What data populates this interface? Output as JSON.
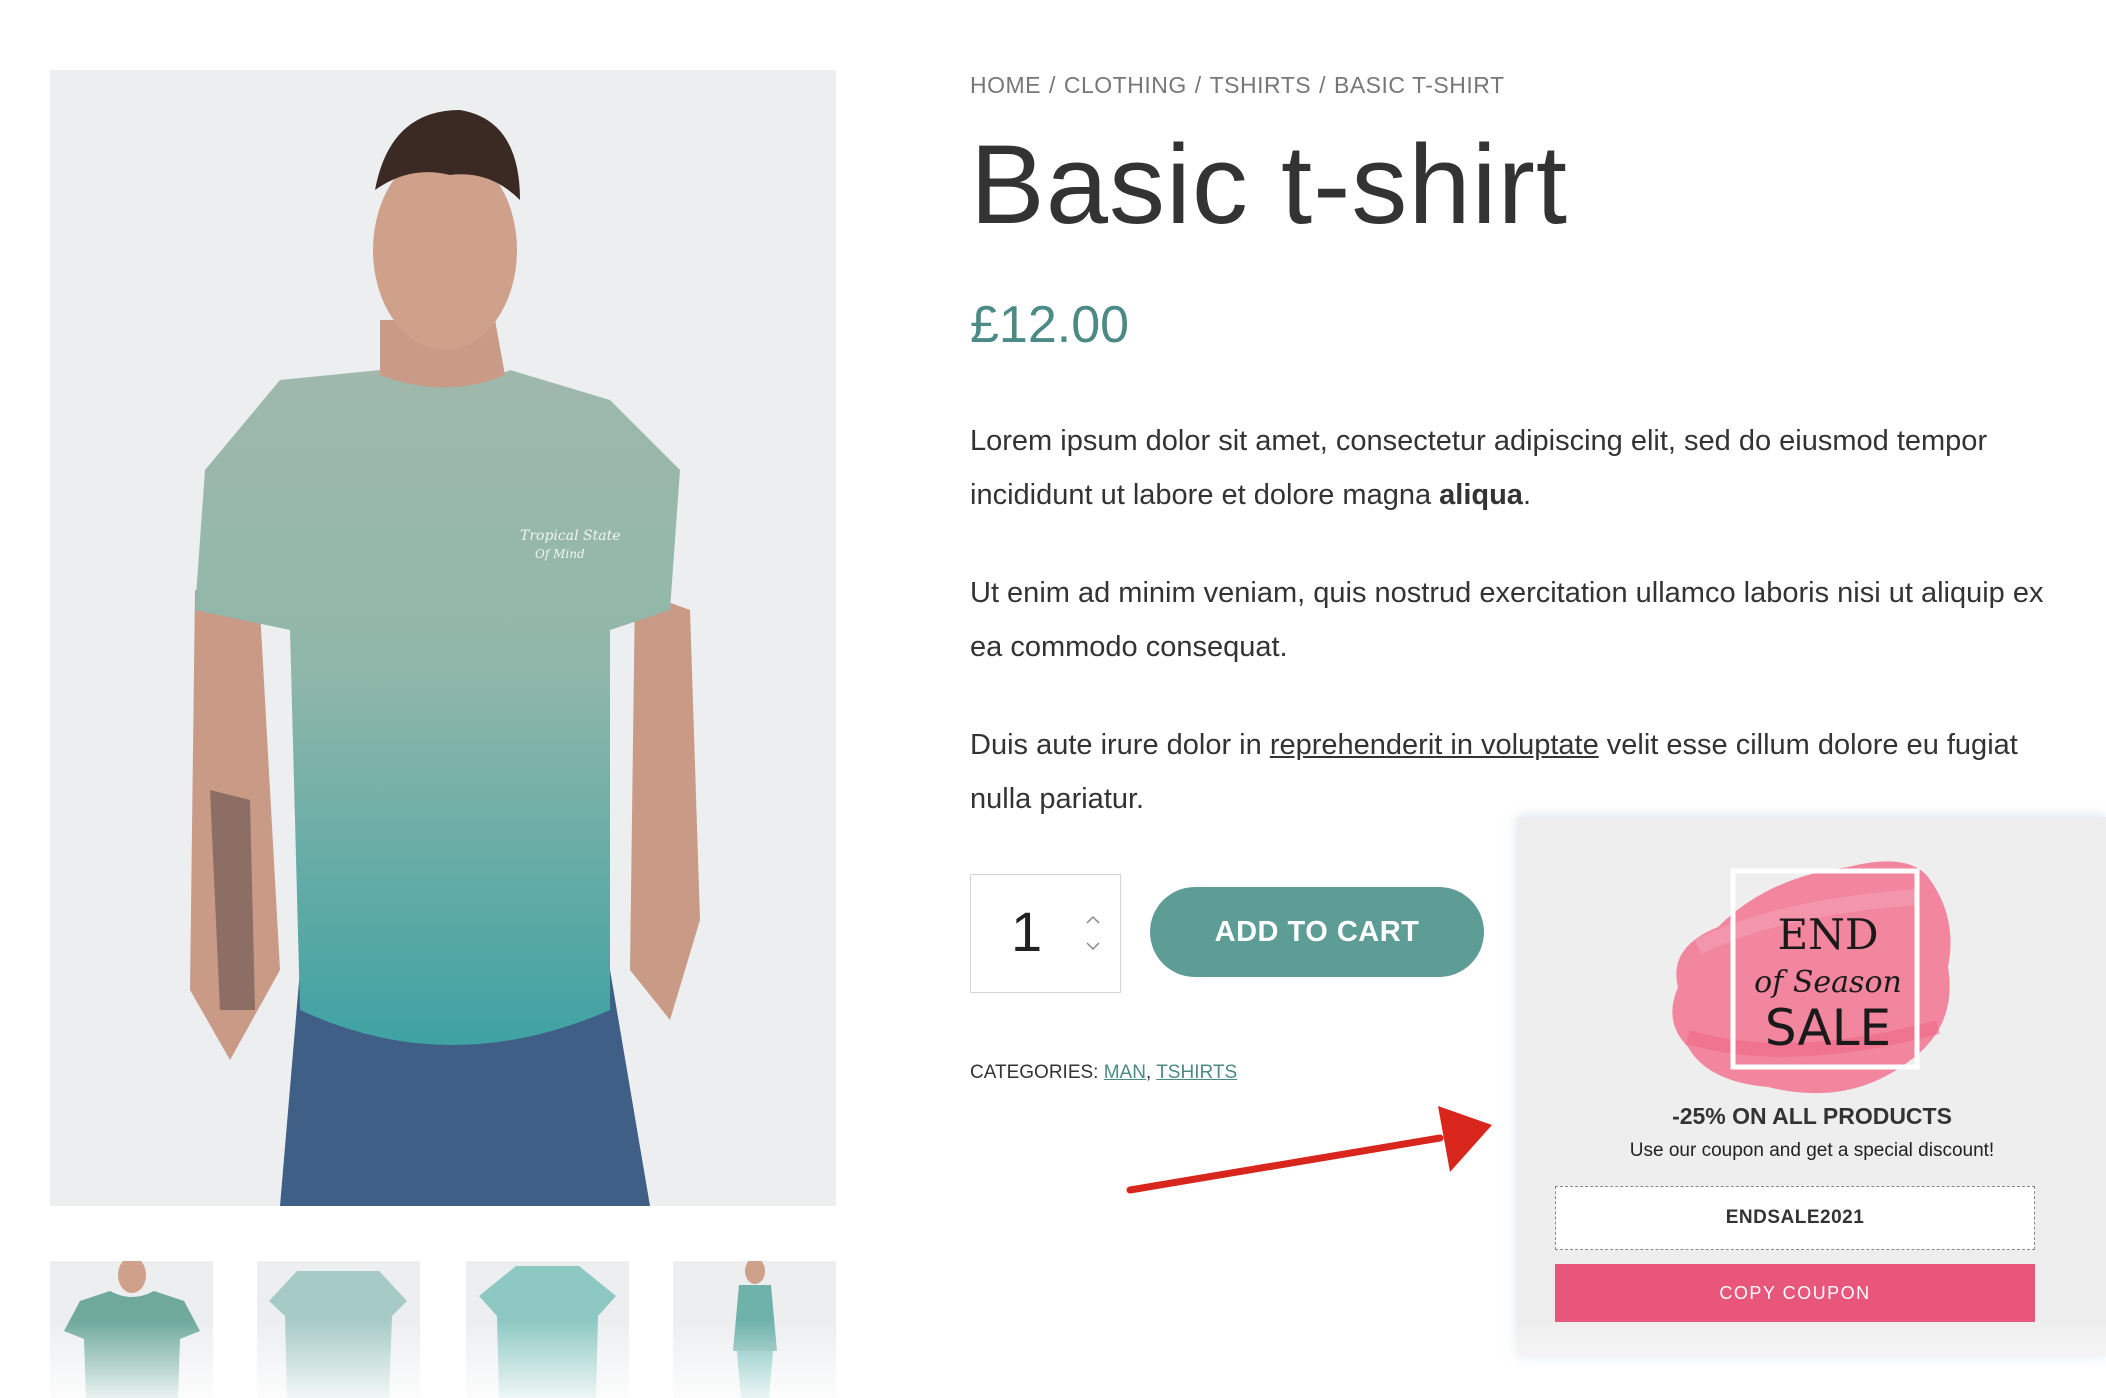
{
  "breadcrumb": {
    "home": "HOME",
    "clothing": "CLOTHING",
    "tshirts": "TSHIRTS",
    "current": "BASIC T-SHIRT",
    "separator": "/"
  },
  "product": {
    "title": "Basic t-shirt",
    "price": "£12.00",
    "description": {
      "p1_text": "Lorem ipsum dolor sit amet, consectetur adipiscing elit, sed do eiusmod tempor incididunt ut labore et dolore magna ",
      "p1_bold": "aliqua",
      "p1_end": ".",
      "p2": "Ut enim ad minim veniam, quis nostrud exercitation ullamco laboris nisi ut aliquip ex ea commodo consequat.",
      "p3_start": "Duis aute irure dolor in ",
      "p3_link": "reprehenderit in voluptate",
      "p3_end": " velit esse cillum dolore eu fugiat nulla pariatur."
    },
    "quantity": "1",
    "add_to_cart_label": "ADD TO CART",
    "categories_label": "CATEGORIES:",
    "categories": [
      "MAN",
      "TSHIRTS"
    ],
    "category_separator": ","
  },
  "popup": {
    "logo": {
      "line1": "END",
      "line2": "of Season",
      "line3": "SALE"
    },
    "headline": "-25% ON ALL PRODUCTS",
    "subtext": "Use our coupon and get a special discount!",
    "coupon_code": "ENDSALE2021",
    "copy_button_label": "COPY COUPON"
  },
  "colors": {
    "accent_teal": "#5e9c96",
    "price_teal": "#4b8a85",
    "coupon_pink": "#e8577b",
    "arrow_red": "#d9261c"
  },
  "icons": {
    "qty_up": "chevron-up-icon",
    "qty_down": "chevron-down-icon",
    "arrow": "red-arrow-icon"
  }
}
